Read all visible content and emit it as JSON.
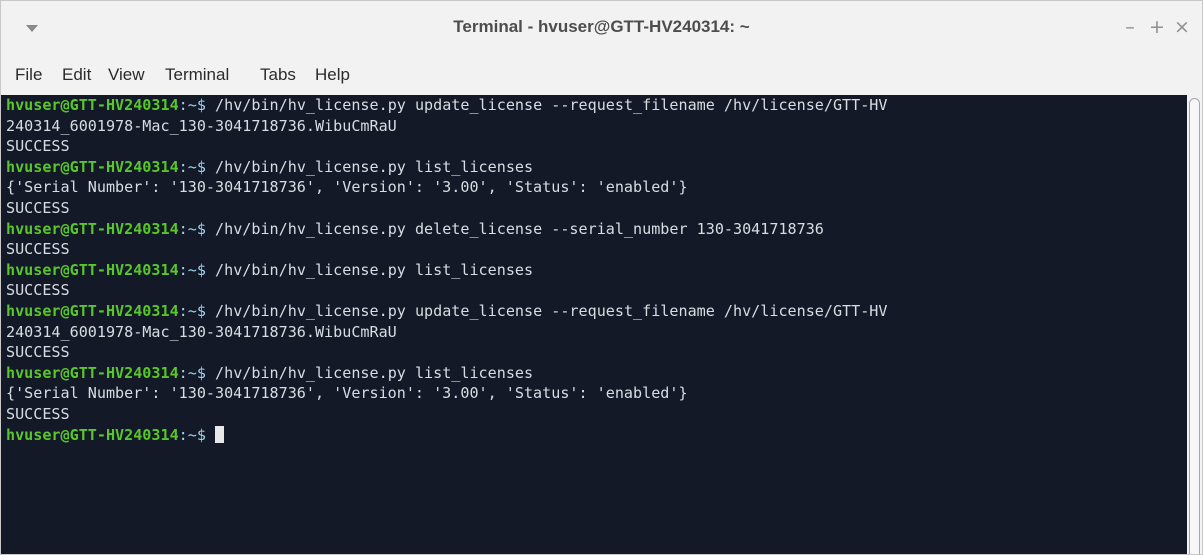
{
  "window": {
    "title": "Terminal - hvuser@GTT-HV240314: ~",
    "buttons": {
      "minimize": "–",
      "maximize": "+",
      "close": "×"
    }
  },
  "menu": [
    "File",
    "Edit",
    "View",
    "Terminal",
    "Tabs",
    "Help"
  ],
  "colors": {
    "terminal_bg": "#131926",
    "prompt_user": "#58c62c",
    "prompt_path": "#9fd2f0",
    "output_text": "#d8dde3"
  },
  "terminal": {
    "prompt_user": "hvuser@GTT-HV240314",
    "prompt_path": ":~$ ",
    "lines": [
      {
        "type": "cmd",
        "text": "/hv/bin/hv_license.py update_license --request_filename /hv/license/GTT-HV"
      },
      {
        "type": "out",
        "text": "240314_6001978-Mac_130-3041718736.WibuCmRaU"
      },
      {
        "type": "out",
        "text": "SUCCESS"
      },
      {
        "type": "cmd",
        "text": "/hv/bin/hv_license.py list_licenses"
      },
      {
        "type": "out",
        "text": "{'Serial Number': '130-3041718736', 'Version': '3.00', 'Status': 'enabled'}"
      },
      {
        "type": "out",
        "text": "SUCCESS"
      },
      {
        "type": "cmd",
        "text": "/hv/bin/hv_license.py delete_license --serial_number 130-3041718736"
      },
      {
        "type": "out",
        "text": "SUCCESS"
      },
      {
        "type": "cmd",
        "text": "/hv/bin/hv_license.py list_licenses"
      },
      {
        "type": "out",
        "text": "SUCCESS"
      },
      {
        "type": "cmd",
        "text": "/hv/bin/hv_license.py update_license --request_filename /hv/license/GTT-HV"
      },
      {
        "type": "out",
        "text": "240314_6001978-Mac_130-3041718736.WibuCmRaU"
      },
      {
        "type": "out",
        "text": "SUCCESS"
      },
      {
        "type": "cmd",
        "text": "/hv/bin/hv_license.py list_licenses"
      },
      {
        "type": "out",
        "text": "{'Serial Number': '130-3041718736', 'Version': '3.00', 'Status': 'enabled'}"
      },
      {
        "type": "out",
        "text": "SUCCESS"
      },
      {
        "type": "prompt",
        "text": ""
      }
    ]
  }
}
